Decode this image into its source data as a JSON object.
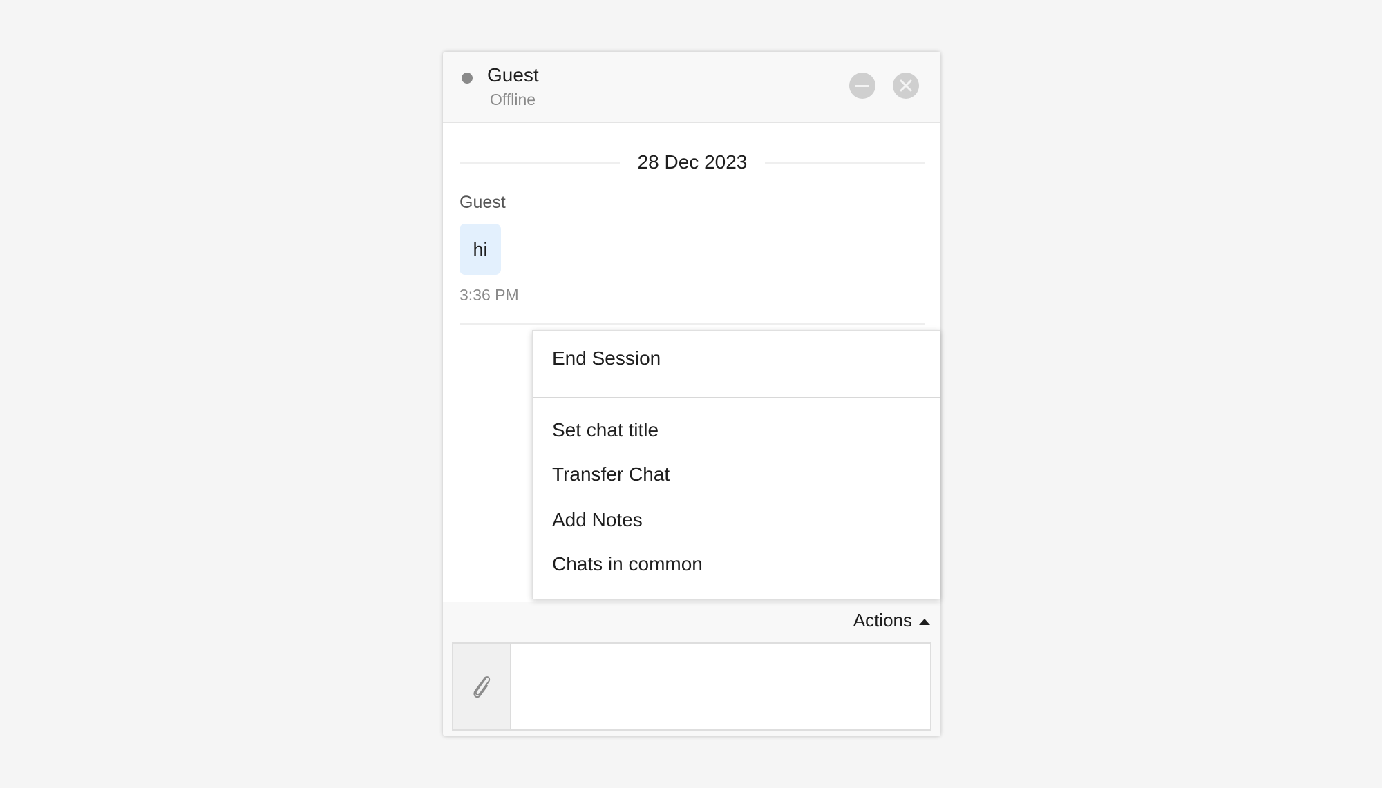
{
  "header": {
    "name": "Guest",
    "status": "Offline",
    "minimize_icon": "minus-circle-icon",
    "close_icon": "x-circle-icon"
  },
  "conversation": {
    "date": "28 Dec 2023",
    "messages": [
      {
        "sender": "Guest",
        "text": "hi",
        "time": "3:36 PM"
      }
    ]
  },
  "actions_menu": {
    "items": [
      {
        "label": "End Session"
      },
      {
        "label": "Set chat title"
      },
      {
        "label": "Transfer Chat"
      },
      {
        "label": "Add Notes"
      },
      {
        "label": "Chats in common"
      }
    ]
  },
  "footer": {
    "actions_label": "Actions",
    "attach_icon": "paperclip-icon",
    "input_placeholder": ""
  },
  "colors": {
    "bubble": "#e3f0fd",
    "status_offline": "#8a8a8a",
    "page_bg": "#f5f5f5"
  }
}
